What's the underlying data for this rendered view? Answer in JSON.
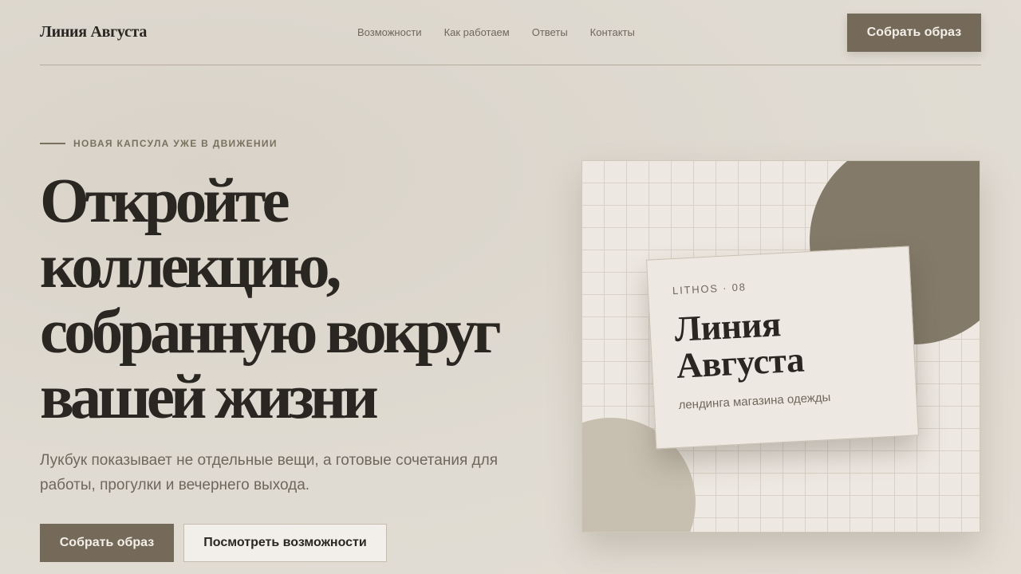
{
  "nav": {
    "brand": "Линия Августа",
    "links": [
      "Возможности",
      "Как работаем",
      "Ответы",
      "Контакты"
    ],
    "cta": "Собрать образ"
  },
  "hero": {
    "eyebrow": "НОВАЯ КАПСУЛА УЖЕ В ДВИЖЕНИИ",
    "headline": [
      "Откройте",
      "коллекцию,",
      "собранную вокруг",
      "вашей жизни"
    ],
    "lead": "Лукбук показывает не отдельные вещи, а готовые сочетания для работы, прогулки и вечернего выхода.",
    "primary_cta": "Собрать образ",
    "secondary_cta": "Посмотреть возможности"
  },
  "card": {
    "code": "LITHOS · 08",
    "title": [
      "Линия",
      "Августа"
    ],
    "subtitle": "лендинга магазина одежды"
  },
  "colors": {
    "accent": "#756a59",
    "text": "#2a2722",
    "muted": "#6e675c",
    "background": "#e0dbd2"
  }
}
